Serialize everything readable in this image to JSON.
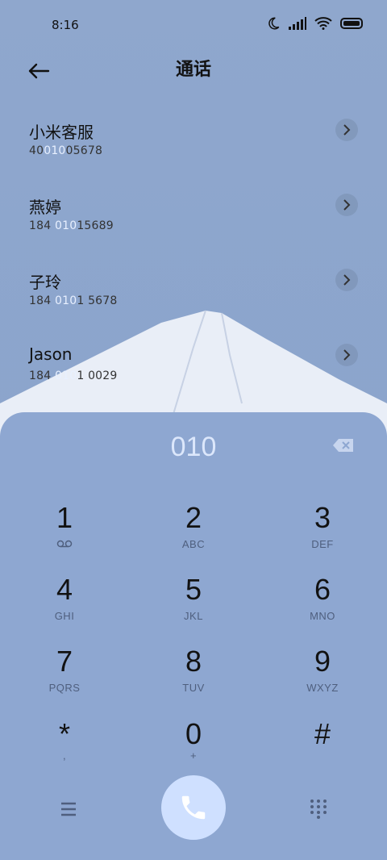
{
  "status": {
    "time": "8:16",
    "icons": [
      "moon-icon",
      "signal-icon",
      "wifi-icon",
      "battery-icon"
    ]
  },
  "header": {
    "title": "通话",
    "back_icon": "arrow-left-icon"
  },
  "results": [
    {
      "name": "小米客服",
      "number_pre": "40",
      "number_match": "010",
      "number_post": "05678"
    },
    {
      "name": "燕婷",
      "number_pre": "184 ",
      "number_match": "010",
      "number_post": "15689"
    },
    {
      "name": "子玲",
      "number_pre": "184 ",
      "number_match": "010",
      "number_post": "1 5678"
    },
    {
      "name": "Jason",
      "number_pre": "184 ",
      "number_match": "010",
      "number_post": "1 0029"
    }
  ],
  "dialpad": {
    "typed": "010",
    "keys": [
      {
        "digit": "1",
        "letters": ""
      },
      {
        "digit": "2",
        "letters": "ABC"
      },
      {
        "digit": "3",
        "letters": "DEF"
      },
      {
        "digit": "4",
        "letters": "GHI"
      },
      {
        "digit": "5",
        "letters": "JKL"
      },
      {
        "digit": "6",
        "letters": "MNO"
      },
      {
        "digit": "7",
        "letters": "PQRS"
      },
      {
        "digit": "8",
        "letters": "TUV"
      },
      {
        "digit": "9",
        "letters": "WXYZ"
      },
      {
        "digit": "*",
        "letters": ","
      },
      {
        "digit": "0",
        "letters": "+"
      },
      {
        "digit": "#",
        "letters": ""
      }
    ]
  },
  "colors": {
    "accent": "#cfe0ff",
    "highlight": "#e8f0ff",
    "background": "#8ea7d1"
  }
}
